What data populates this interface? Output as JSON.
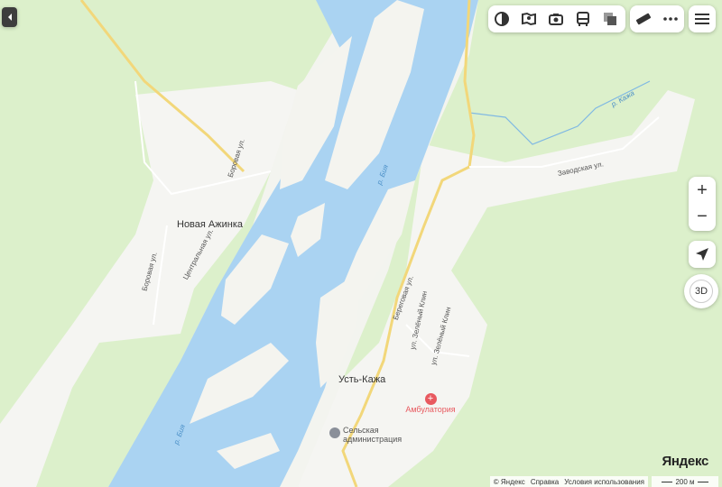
{
  "map": {
    "settlements": [
      {
        "name": "Новая Ажинка"
      },
      {
        "name": "Усть-Кажа"
      }
    ],
    "streets": [
      {
        "name": "Боровая ул."
      },
      {
        "name": "Центральная ул."
      },
      {
        "name": "Боровая ул."
      },
      {
        "name": "Береговая ул."
      },
      {
        "name": "ул. Зелёный Клин"
      },
      {
        "name": "ул. Зелёный Клин"
      },
      {
        "name": "Заводская ул."
      }
    ],
    "rivers": [
      {
        "name": "р. Бия"
      },
      {
        "name": "р. Бия"
      },
      {
        "name": "р. Кажа"
      }
    ],
    "pois": [
      {
        "name": "Амбулатория",
        "icon": "hospital-icon",
        "color": "#e8595f"
      },
      {
        "name_line1": "Сельская",
        "name_line2": "администрация",
        "icon": "admin-building-icon"
      }
    ],
    "colors": {
      "water": "#aad3f2",
      "forest": "#d4efc0",
      "built": "#f4f4f2",
      "road": "#f6e08e"
    }
  },
  "toolbar": {
    "items": [
      {
        "icon": "layers-icon"
      },
      {
        "icon": "panorama-icon"
      },
      {
        "icon": "photo-camera-icon"
      },
      {
        "icon": "bus-transport-icon"
      },
      {
        "icon": "map-layers-icon"
      }
    ],
    "extra": [
      {
        "icon": "ruler-icon"
      },
      {
        "icon": "more-dots-icon"
      }
    ],
    "menu_icon": "hamburger-menu-icon"
  },
  "controls": {
    "zoom_in": "+",
    "zoom_out": "−",
    "three_d": "3D"
  },
  "footer": {
    "brand": "Яндекс",
    "copyright": "© Яндекс",
    "help": "Справка",
    "terms": "Условия использования",
    "scale": "200 м"
  }
}
